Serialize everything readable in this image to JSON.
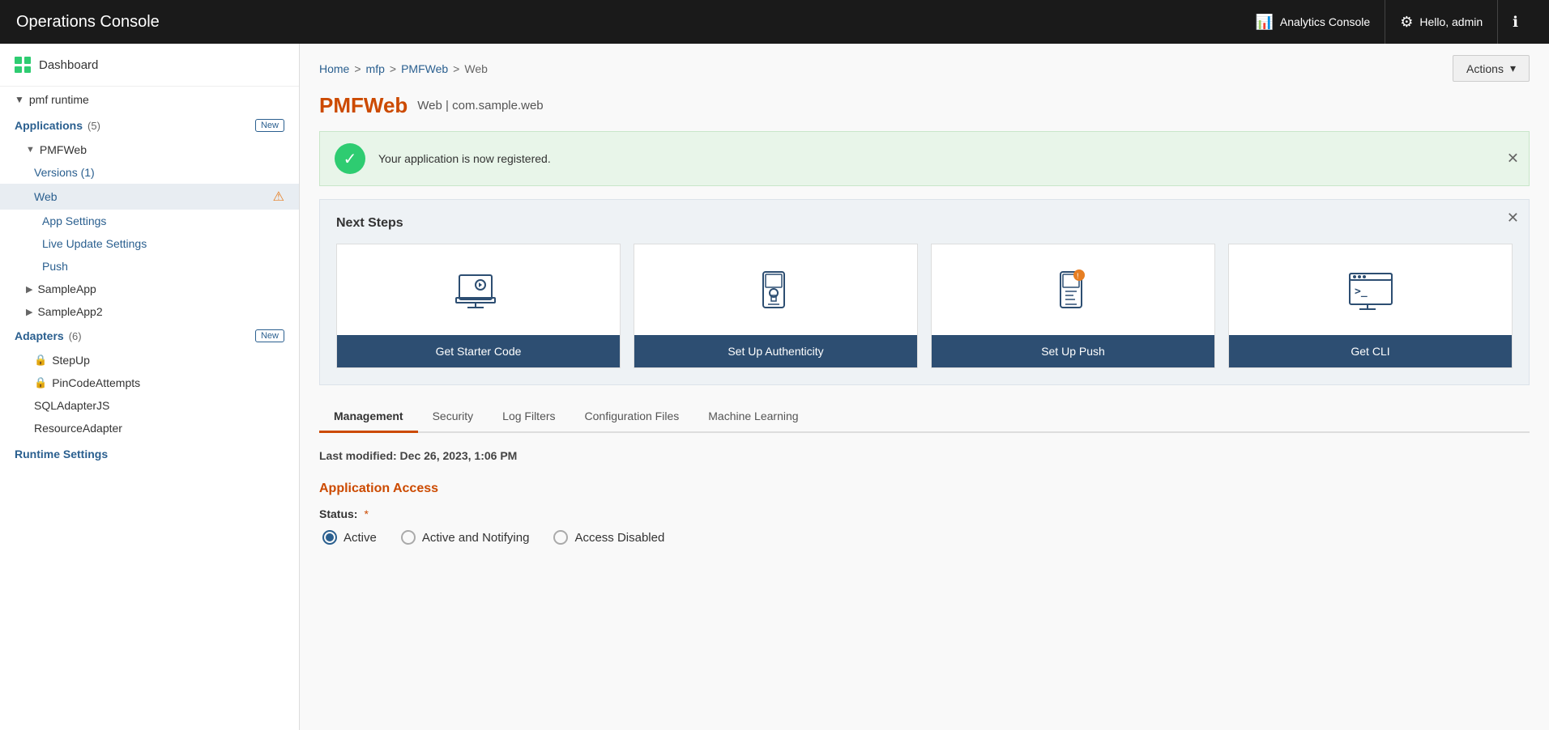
{
  "topNav": {
    "title": "Operations Console",
    "analyticsLabel": "Analytics Console",
    "userLabel": "Hello, admin",
    "infoLabel": "ℹ"
  },
  "sidebar": {
    "dashboardLabel": "Dashboard",
    "runtimeLabel": "pmf runtime",
    "applications": {
      "label": "Applications",
      "count": "(5)",
      "badge": "New",
      "items": [
        {
          "label": "PMFWeb",
          "children": [
            {
              "label": "Versions (1)"
            },
            {
              "label": "Web",
              "selected": true,
              "warning": true
            },
            {
              "label": "App Settings"
            },
            {
              "label": "Live Update Settings"
            },
            {
              "label": "Push"
            }
          ]
        },
        {
          "label": "SampleApp"
        },
        {
          "label": "SampleApp2"
        }
      ]
    },
    "adapters": {
      "label": "Adapters",
      "count": "(6)",
      "badge": "New",
      "items": [
        {
          "label": "StepUp",
          "hasLock": true
        },
        {
          "label": "PinCodeAttempts",
          "hasLock": true
        },
        {
          "label": "SQLAdapterJS"
        },
        {
          "label": "ResourceAdapter"
        }
      ]
    },
    "runtimeSettings": "Runtime Settings"
  },
  "breadcrumb": {
    "items": [
      "Home",
      "mfp",
      "PMFWeb",
      "Web"
    ],
    "separators": [
      ">",
      ">",
      ">"
    ]
  },
  "actions": {
    "label": "Actions"
  },
  "page": {
    "title": "PMFWeb",
    "subtitle": "Web | com.sample.web"
  },
  "successBanner": {
    "message": "Your application is now registered."
  },
  "nextSteps": {
    "title": "Next Steps",
    "cards": [
      {
        "label": "Get Starter Code",
        "iconType": "download"
      },
      {
        "label": "Set Up Authenticity",
        "iconType": "lock-phone"
      },
      {
        "label": "Set Up Push",
        "iconType": "push-phone"
      },
      {
        "label": "Get CLI",
        "iconType": "terminal"
      }
    ]
  },
  "tabs": [
    {
      "label": "Management",
      "active": true
    },
    {
      "label": "Security"
    },
    {
      "label": "Log Filters"
    },
    {
      "label": "Configuration Files"
    },
    {
      "label": "Machine Learning"
    }
  ],
  "management": {
    "lastModified": "Last modified: Dec 26, 2023, 1:06 PM",
    "applicationAccess": {
      "sectionTitle": "Application Access",
      "statusLabel": "Status:",
      "statusOptions": [
        {
          "label": "Active",
          "selected": true
        },
        {
          "label": "Active and Notifying",
          "selected": false
        },
        {
          "label": "Access Disabled",
          "selected": false
        }
      ]
    }
  }
}
